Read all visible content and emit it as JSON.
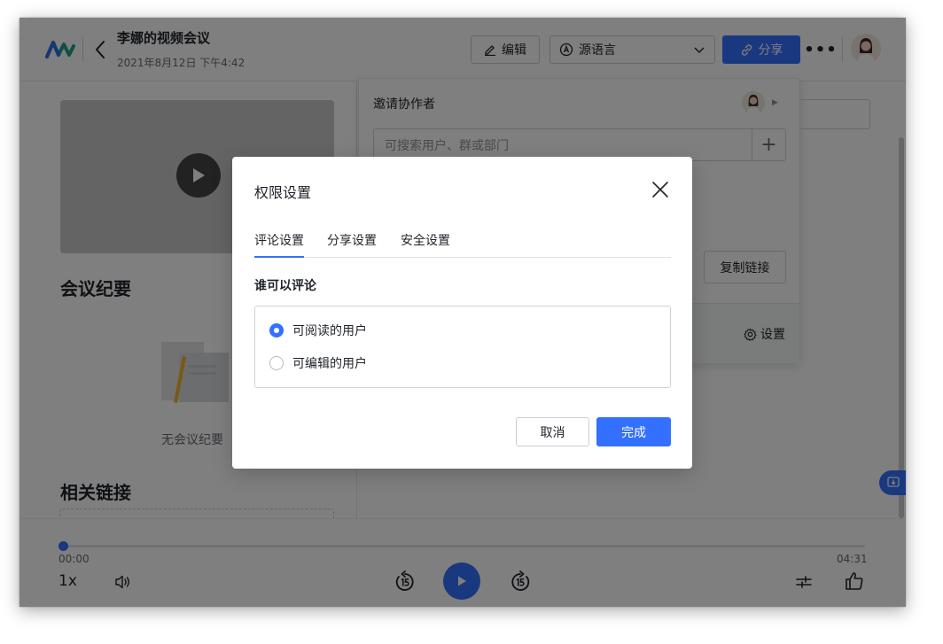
{
  "header": {
    "title": "李娜的视频会议",
    "subtitle": "2021年8月12日 下午4:42",
    "edit_label": "编辑",
    "lang_label": "源语言",
    "share_label": "分享"
  },
  "left": {
    "minutes_heading": "会议纪要",
    "empty_text": "无会议纪要",
    "links_heading": "相关链接"
  },
  "share_panel": {
    "title": "邀请协作者",
    "search_placeholder": "可搜索用户、群或部门",
    "copy_link": "复制链接",
    "settings": "设置"
  },
  "player": {
    "current_time": "00:00",
    "duration": "04:31",
    "speed": "1x",
    "progress": 0
  },
  "modal": {
    "title": "权限设置",
    "tabs": [
      "评论设置",
      "分享设置",
      "安全设置"
    ],
    "active_tab": "评论设置",
    "question": "谁可以评论",
    "options": [
      "可阅读的用户",
      "可编辑的用户"
    ],
    "selected_option": "可阅读的用户",
    "cancel": "取消",
    "done": "完成"
  },
  "colors": {
    "accent": "#3370ff",
    "text": "#1f2329",
    "muted": "#646a73"
  }
}
